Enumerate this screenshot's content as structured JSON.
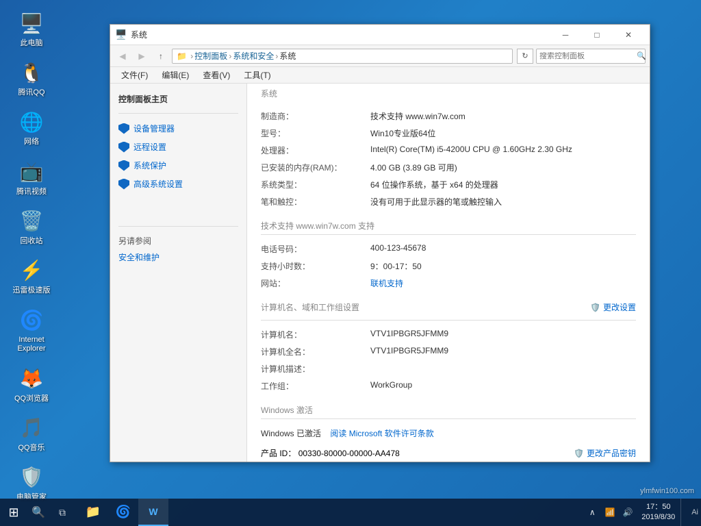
{
  "desktop": {
    "icons": [
      {
        "id": "my-computer",
        "label": "此电脑",
        "emoji": "🖥️"
      },
      {
        "id": "qq",
        "label": "腾讯QQ",
        "emoji": "🐧"
      },
      {
        "id": "network",
        "label": "网络",
        "emoji": "🌐"
      },
      {
        "id": "tencent-video",
        "label": "腾讯视频",
        "emoji": "📺"
      },
      {
        "id": "recycle-bin",
        "label": "回收站",
        "emoji": "🗑️"
      },
      {
        "id": "xunlei",
        "label": "迅雷极速版",
        "emoji": "⚡"
      },
      {
        "id": "ie",
        "label": "Internet Explorer",
        "emoji": "🌀"
      },
      {
        "id": "qq-browser",
        "label": "QQ浏览器",
        "emoji": "🔵"
      },
      {
        "id": "qq-music",
        "label": "QQ音乐",
        "emoji": "🎵"
      },
      {
        "id": "dian-nao-guanjia",
        "label": "电脑管家",
        "emoji": "🛡️"
      }
    ]
  },
  "taskbar": {
    "start_icon": "⊞",
    "search_icon": "🔍",
    "task_view_icon": "⧉",
    "apps": [
      {
        "id": "explorer",
        "emoji": "📁",
        "active": false
      },
      {
        "id": "ie",
        "emoji": "🌀",
        "active": false
      },
      {
        "id": "word",
        "emoji": "W",
        "active": true
      }
    ],
    "tray": {
      "up_arrow": "∧",
      "network_icon": "📶",
      "volume_icon": "🔊",
      "clock_line1": "17：50",
      "clock_line2": "2019/8/30"
    },
    "ai_label": "Ai"
  },
  "window": {
    "icon": "🖥️",
    "title": "系统",
    "controls": {
      "minimize": "─",
      "maximize": "□",
      "close": "✕"
    },
    "address": {
      "back": "◀",
      "forward": "▶",
      "up": "↑",
      "path_parts": [
        "控制面板",
        "系统和安全",
        "系统"
      ],
      "refresh": "↻",
      "search_placeholder": "搜索控制面板"
    },
    "menu": [
      "文件(F)",
      "编辑(E)",
      "查看(V)",
      "工具(T)"
    ],
    "sidebar": {
      "main_title": "控制面板主页",
      "links": [
        {
          "id": "device-manager",
          "label": "设备管理器"
        },
        {
          "id": "remote-settings",
          "label": "远程设置"
        },
        {
          "id": "system-protect",
          "label": "系统保护"
        },
        {
          "id": "advanced-settings",
          "label": "高级系统设置"
        }
      ],
      "also_see_title": "另请参阅",
      "also_links": [
        {
          "id": "security",
          "label": "安全和维护"
        }
      ]
    },
    "content": {
      "top_label": "系统",
      "section1": {
        "rows": [
          {
            "label": "制造商：",
            "value": "技术支持 www.win7w.com"
          },
          {
            "label": "型号：",
            "value": "Win10专业版64位"
          },
          {
            "label": "处理器：",
            "value": "Intel(R) Core(TM) i5-4200U CPU @ 1.60GHz   2.30 GHz"
          },
          {
            "label": "已安装的内存(RAM)：",
            "value": "4.00 GB (3.89 GB 可用)"
          },
          {
            "label": "系统类型：",
            "value": "64 位操作系统，基于 x64 的处理器"
          },
          {
            "label": "笔和触控：",
            "value": "没有可用于此显示器的笔或触控输入"
          }
        ]
      },
      "section2_header": "技术支持 www.win7w.com 支持",
      "section2": {
        "rows": [
          {
            "label": "电话号码：",
            "value": "400-123-45678"
          },
          {
            "label": "支持小时数：",
            "value": "9：00-17：50"
          },
          {
            "label": "网站：",
            "value": "联机支持",
            "is_link": true
          }
        ]
      },
      "section3_header": "计算机名、域和工作组设置",
      "section3": {
        "change_btn": "更改设置",
        "rows": [
          {
            "label": "计算机名：",
            "value": "VTV1IPBGR5JFMM9"
          },
          {
            "label": "计算机全名：",
            "value": "VTV1IPBGR5JFMM9"
          },
          {
            "label": "计算机描述：",
            "value": ""
          },
          {
            "label": "工作组：",
            "value": "WorkGroup"
          }
        ]
      },
      "section4_header": "Windows 激活",
      "section4": {
        "activated_text": "Windows 已激活",
        "license_link": "阅读 Microsoft 软件许可条款",
        "product_id_label": "产品 ID：",
        "product_id_value": "00330-80000-00000-AA478",
        "change_key_btn": "更改产品密钥"
      }
    }
  },
  "watermark": "ylmfwin100.com"
}
